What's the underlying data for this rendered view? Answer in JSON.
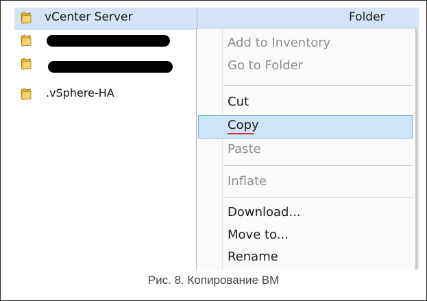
{
  "tree": {
    "header": {
      "name": "vCenter Server",
      "type": "Folder"
    },
    "items": [
      {
        "label": ""
      },
      {
        "label": ""
      },
      {
        "label": ".vSphere-HA"
      }
    ]
  },
  "context_menu": {
    "items": [
      {
        "label": "Add to Inventory",
        "enabled": false
      },
      {
        "label": "Go to Folder",
        "enabled": false
      },
      {
        "label": "Cut",
        "enabled": true
      },
      {
        "label": "Copy",
        "enabled": true,
        "highlighted": true
      },
      {
        "label": "Paste",
        "enabled": false
      },
      {
        "label": "Inflate",
        "enabled": false
      },
      {
        "label": "Download...",
        "enabled": true
      },
      {
        "label": "Move to...",
        "enabled": true
      },
      {
        "label": "Rename",
        "enabled": true
      }
    ]
  },
  "caption": "Рис. 8. Копирование ВМ",
  "colors": {
    "header_bg": "#d4e3f5",
    "highlight": "#cfe4f7",
    "folder": "#e8b830"
  }
}
